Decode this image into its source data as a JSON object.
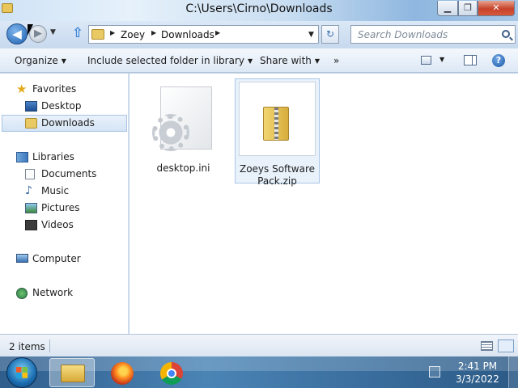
{
  "window": {
    "title": "C:\\Users\\Cirno\\Downloads",
    "minimize": "▁",
    "maximize": "❐",
    "close": "✕"
  },
  "nav": {
    "back_glyph": "◀",
    "forward_glyph": "▶",
    "up_glyph": "⇧",
    "breadcrumbs": [
      "Zoey",
      "Downloads"
    ],
    "refresh_glyph": "↻",
    "search_placeholder": "Search Downloads"
  },
  "command_bar": {
    "organize": "Organize",
    "include_in_library": "Include selected folder in library",
    "share_with": "Share with",
    "more": "»",
    "help": "?"
  },
  "sidebar": {
    "favorites": {
      "label": "Favorites",
      "items": [
        {
          "label": "Desktop",
          "icon": "desktop-icon"
        },
        {
          "label": "Downloads",
          "icon": "folder-icon",
          "selected": true
        }
      ]
    },
    "libraries": {
      "label": "Libraries",
      "items": [
        {
          "label": "Documents",
          "icon": "documents-icon"
        },
        {
          "label": "Music",
          "icon": "music-icon"
        },
        {
          "label": "Pictures",
          "icon": "pictures-icon"
        },
        {
          "label": "Videos",
          "icon": "videos-icon"
        }
      ]
    },
    "computer": {
      "label": "Computer"
    },
    "network": {
      "label": "Network"
    }
  },
  "files": [
    {
      "name": "desktop.ini",
      "icon": "ini-file-icon",
      "selected": false
    },
    {
      "name": "Zoeys Software Pack.zip",
      "icon": "zip-folder-icon",
      "selected": true
    }
  ],
  "status": {
    "item_count": "2 items"
  },
  "taskbar": {
    "pinned": [
      {
        "name": "Windows Explorer",
        "icon": "explorer-icon",
        "active": true
      },
      {
        "name": "Firefox",
        "icon": "firefox-icon",
        "active": false
      },
      {
        "name": "Chrome",
        "icon": "chrome-icon",
        "active": false
      }
    ],
    "time": "2:41 PM",
    "date": "3/3/2022"
  }
}
